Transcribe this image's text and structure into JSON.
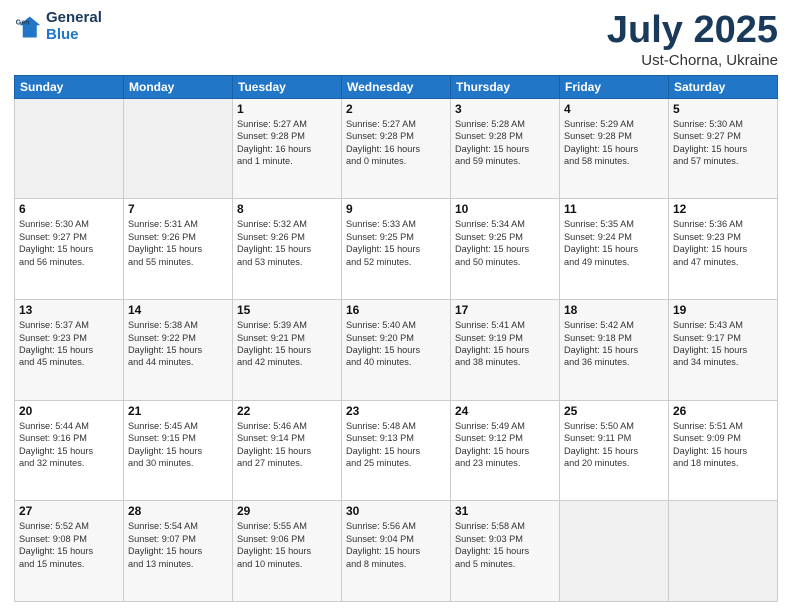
{
  "header": {
    "logo_line1": "General",
    "logo_line2": "Blue",
    "title": "July 2025",
    "subtitle": "Ust-Chorna, Ukraine"
  },
  "days_of_week": [
    "Sunday",
    "Monday",
    "Tuesday",
    "Wednesday",
    "Thursday",
    "Friday",
    "Saturday"
  ],
  "weeks": [
    [
      {
        "day": "",
        "info": ""
      },
      {
        "day": "",
        "info": ""
      },
      {
        "day": "1",
        "info": "Sunrise: 5:27 AM\nSunset: 9:28 PM\nDaylight: 16 hours\nand 1 minute."
      },
      {
        "day": "2",
        "info": "Sunrise: 5:27 AM\nSunset: 9:28 PM\nDaylight: 16 hours\nand 0 minutes."
      },
      {
        "day": "3",
        "info": "Sunrise: 5:28 AM\nSunset: 9:28 PM\nDaylight: 15 hours\nand 59 minutes."
      },
      {
        "day": "4",
        "info": "Sunrise: 5:29 AM\nSunset: 9:28 PM\nDaylight: 15 hours\nand 58 minutes."
      },
      {
        "day": "5",
        "info": "Sunrise: 5:30 AM\nSunset: 9:27 PM\nDaylight: 15 hours\nand 57 minutes."
      }
    ],
    [
      {
        "day": "6",
        "info": "Sunrise: 5:30 AM\nSunset: 9:27 PM\nDaylight: 15 hours\nand 56 minutes."
      },
      {
        "day": "7",
        "info": "Sunrise: 5:31 AM\nSunset: 9:26 PM\nDaylight: 15 hours\nand 55 minutes."
      },
      {
        "day": "8",
        "info": "Sunrise: 5:32 AM\nSunset: 9:26 PM\nDaylight: 15 hours\nand 53 minutes."
      },
      {
        "day": "9",
        "info": "Sunrise: 5:33 AM\nSunset: 9:25 PM\nDaylight: 15 hours\nand 52 minutes."
      },
      {
        "day": "10",
        "info": "Sunrise: 5:34 AM\nSunset: 9:25 PM\nDaylight: 15 hours\nand 50 minutes."
      },
      {
        "day": "11",
        "info": "Sunrise: 5:35 AM\nSunset: 9:24 PM\nDaylight: 15 hours\nand 49 minutes."
      },
      {
        "day": "12",
        "info": "Sunrise: 5:36 AM\nSunset: 9:23 PM\nDaylight: 15 hours\nand 47 minutes."
      }
    ],
    [
      {
        "day": "13",
        "info": "Sunrise: 5:37 AM\nSunset: 9:23 PM\nDaylight: 15 hours\nand 45 minutes."
      },
      {
        "day": "14",
        "info": "Sunrise: 5:38 AM\nSunset: 9:22 PM\nDaylight: 15 hours\nand 44 minutes."
      },
      {
        "day": "15",
        "info": "Sunrise: 5:39 AM\nSunset: 9:21 PM\nDaylight: 15 hours\nand 42 minutes."
      },
      {
        "day": "16",
        "info": "Sunrise: 5:40 AM\nSunset: 9:20 PM\nDaylight: 15 hours\nand 40 minutes."
      },
      {
        "day": "17",
        "info": "Sunrise: 5:41 AM\nSunset: 9:19 PM\nDaylight: 15 hours\nand 38 minutes."
      },
      {
        "day": "18",
        "info": "Sunrise: 5:42 AM\nSunset: 9:18 PM\nDaylight: 15 hours\nand 36 minutes."
      },
      {
        "day": "19",
        "info": "Sunrise: 5:43 AM\nSunset: 9:17 PM\nDaylight: 15 hours\nand 34 minutes."
      }
    ],
    [
      {
        "day": "20",
        "info": "Sunrise: 5:44 AM\nSunset: 9:16 PM\nDaylight: 15 hours\nand 32 minutes."
      },
      {
        "day": "21",
        "info": "Sunrise: 5:45 AM\nSunset: 9:15 PM\nDaylight: 15 hours\nand 30 minutes."
      },
      {
        "day": "22",
        "info": "Sunrise: 5:46 AM\nSunset: 9:14 PM\nDaylight: 15 hours\nand 27 minutes."
      },
      {
        "day": "23",
        "info": "Sunrise: 5:48 AM\nSunset: 9:13 PM\nDaylight: 15 hours\nand 25 minutes."
      },
      {
        "day": "24",
        "info": "Sunrise: 5:49 AM\nSunset: 9:12 PM\nDaylight: 15 hours\nand 23 minutes."
      },
      {
        "day": "25",
        "info": "Sunrise: 5:50 AM\nSunset: 9:11 PM\nDaylight: 15 hours\nand 20 minutes."
      },
      {
        "day": "26",
        "info": "Sunrise: 5:51 AM\nSunset: 9:09 PM\nDaylight: 15 hours\nand 18 minutes."
      }
    ],
    [
      {
        "day": "27",
        "info": "Sunrise: 5:52 AM\nSunset: 9:08 PM\nDaylight: 15 hours\nand 15 minutes."
      },
      {
        "day": "28",
        "info": "Sunrise: 5:54 AM\nSunset: 9:07 PM\nDaylight: 15 hours\nand 13 minutes."
      },
      {
        "day": "29",
        "info": "Sunrise: 5:55 AM\nSunset: 9:06 PM\nDaylight: 15 hours\nand 10 minutes."
      },
      {
        "day": "30",
        "info": "Sunrise: 5:56 AM\nSunset: 9:04 PM\nDaylight: 15 hours\nand 8 minutes."
      },
      {
        "day": "31",
        "info": "Sunrise: 5:58 AM\nSunset: 9:03 PM\nDaylight: 15 hours\nand 5 minutes."
      },
      {
        "day": "",
        "info": ""
      },
      {
        "day": "",
        "info": ""
      }
    ]
  ]
}
